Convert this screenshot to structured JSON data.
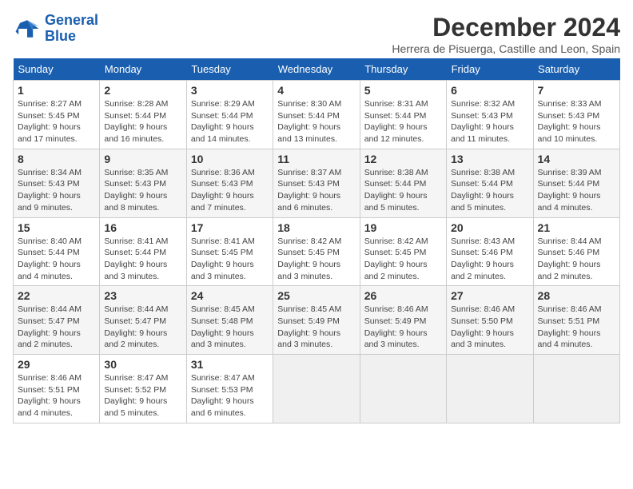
{
  "header": {
    "logo_line1": "General",
    "logo_line2": "Blue",
    "month_title": "December 2024",
    "location": "Herrera de Pisuerga, Castille and Leon, Spain"
  },
  "days": [
    "Sunday",
    "Monday",
    "Tuesday",
    "Wednesday",
    "Thursday",
    "Friday",
    "Saturday"
  ],
  "weeks": [
    [
      {
        "date": "1",
        "sunrise": "8:27 AM",
        "sunset": "5:45 PM",
        "daylight": "9 hours and 17 minutes."
      },
      {
        "date": "2",
        "sunrise": "8:28 AM",
        "sunset": "5:44 PM",
        "daylight": "9 hours and 16 minutes."
      },
      {
        "date": "3",
        "sunrise": "8:29 AM",
        "sunset": "5:44 PM",
        "daylight": "9 hours and 14 minutes."
      },
      {
        "date": "4",
        "sunrise": "8:30 AM",
        "sunset": "5:44 PM",
        "daylight": "9 hours and 13 minutes."
      },
      {
        "date": "5",
        "sunrise": "8:31 AM",
        "sunset": "5:44 PM",
        "daylight": "9 hours and 12 minutes."
      },
      {
        "date": "6",
        "sunrise": "8:32 AM",
        "sunset": "5:43 PM",
        "daylight": "9 hours and 11 minutes."
      },
      {
        "date": "7",
        "sunrise": "8:33 AM",
        "sunset": "5:43 PM",
        "daylight": "9 hours and 10 minutes."
      }
    ],
    [
      {
        "date": "8",
        "sunrise": "8:34 AM",
        "sunset": "5:43 PM",
        "daylight": "9 hours and 9 minutes."
      },
      {
        "date": "9",
        "sunrise": "8:35 AM",
        "sunset": "5:43 PM",
        "daylight": "9 hours and 8 minutes."
      },
      {
        "date": "10",
        "sunrise": "8:36 AM",
        "sunset": "5:43 PM",
        "daylight": "9 hours and 7 minutes."
      },
      {
        "date": "11",
        "sunrise": "8:37 AM",
        "sunset": "5:43 PM",
        "daylight": "9 hours and 6 minutes."
      },
      {
        "date": "12",
        "sunrise": "8:38 AM",
        "sunset": "5:44 PM",
        "daylight": "9 hours and 5 minutes."
      },
      {
        "date": "13",
        "sunrise": "8:38 AM",
        "sunset": "5:44 PM",
        "daylight": "9 hours and 5 minutes."
      },
      {
        "date": "14",
        "sunrise": "8:39 AM",
        "sunset": "5:44 PM",
        "daylight": "9 hours and 4 minutes."
      }
    ],
    [
      {
        "date": "15",
        "sunrise": "8:40 AM",
        "sunset": "5:44 PM",
        "daylight": "9 hours and 4 minutes."
      },
      {
        "date": "16",
        "sunrise": "8:41 AM",
        "sunset": "5:44 PM",
        "daylight": "9 hours and 3 minutes."
      },
      {
        "date": "17",
        "sunrise": "8:41 AM",
        "sunset": "5:45 PM",
        "daylight": "9 hours and 3 minutes."
      },
      {
        "date": "18",
        "sunrise": "8:42 AM",
        "sunset": "5:45 PM",
        "daylight": "9 hours and 3 minutes."
      },
      {
        "date": "19",
        "sunrise": "8:42 AM",
        "sunset": "5:45 PM",
        "daylight": "9 hours and 2 minutes."
      },
      {
        "date": "20",
        "sunrise": "8:43 AM",
        "sunset": "5:46 PM",
        "daylight": "9 hours and 2 minutes."
      },
      {
        "date": "21",
        "sunrise": "8:44 AM",
        "sunset": "5:46 PM",
        "daylight": "9 hours and 2 minutes."
      }
    ],
    [
      {
        "date": "22",
        "sunrise": "8:44 AM",
        "sunset": "5:47 PM",
        "daylight": "9 hours and 2 minutes."
      },
      {
        "date": "23",
        "sunrise": "8:44 AM",
        "sunset": "5:47 PM",
        "daylight": "9 hours and 2 minutes."
      },
      {
        "date": "24",
        "sunrise": "8:45 AM",
        "sunset": "5:48 PM",
        "daylight": "9 hours and 3 minutes."
      },
      {
        "date": "25",
        "sunrise": "8:45 AM",
        "sunset": "5:49 PM",
        "daylight": "9 hours and 3 minutes."
      },
      {
        "date": "26",
        "sunrise": "8:46 AM",
        "sunset": "5:49 PM",
        "daylight": "9 hours and 3 minutes."
      },
      {
        "date": "27",
        "sunrise": "8:46 AM",
        "sunset": "5:50 PM",
        "daylight": "9 hours and 3 minutes."
      },
      {
        "date": "28",
        "sunrise": "8:46 AM",
        "sunset": "5:51 PM",
        "daylight": "9 hours and 4 minutes."
      }
    ],
    [
      {
        "date": "29",
        "sunrise": "8:46 AM",
        "sunset": "5:51 PM",
        "daylight": "9 hours and 4 minutes."
      },
      {
        "date": "30",
        "sunrise": "8:47 AM",
        "sunset": "5:52 PM",
        "daylight": "9 hours and 5 minutes."
      },
      {
        "date": "31",
        "sunrise": "8:47 AM",
        "sunset": "5:53 PM",
        "daylight": "9 hours and 6 minutes."
      },
      null,
      null,
      null,
      null
    ]
  ]
}
